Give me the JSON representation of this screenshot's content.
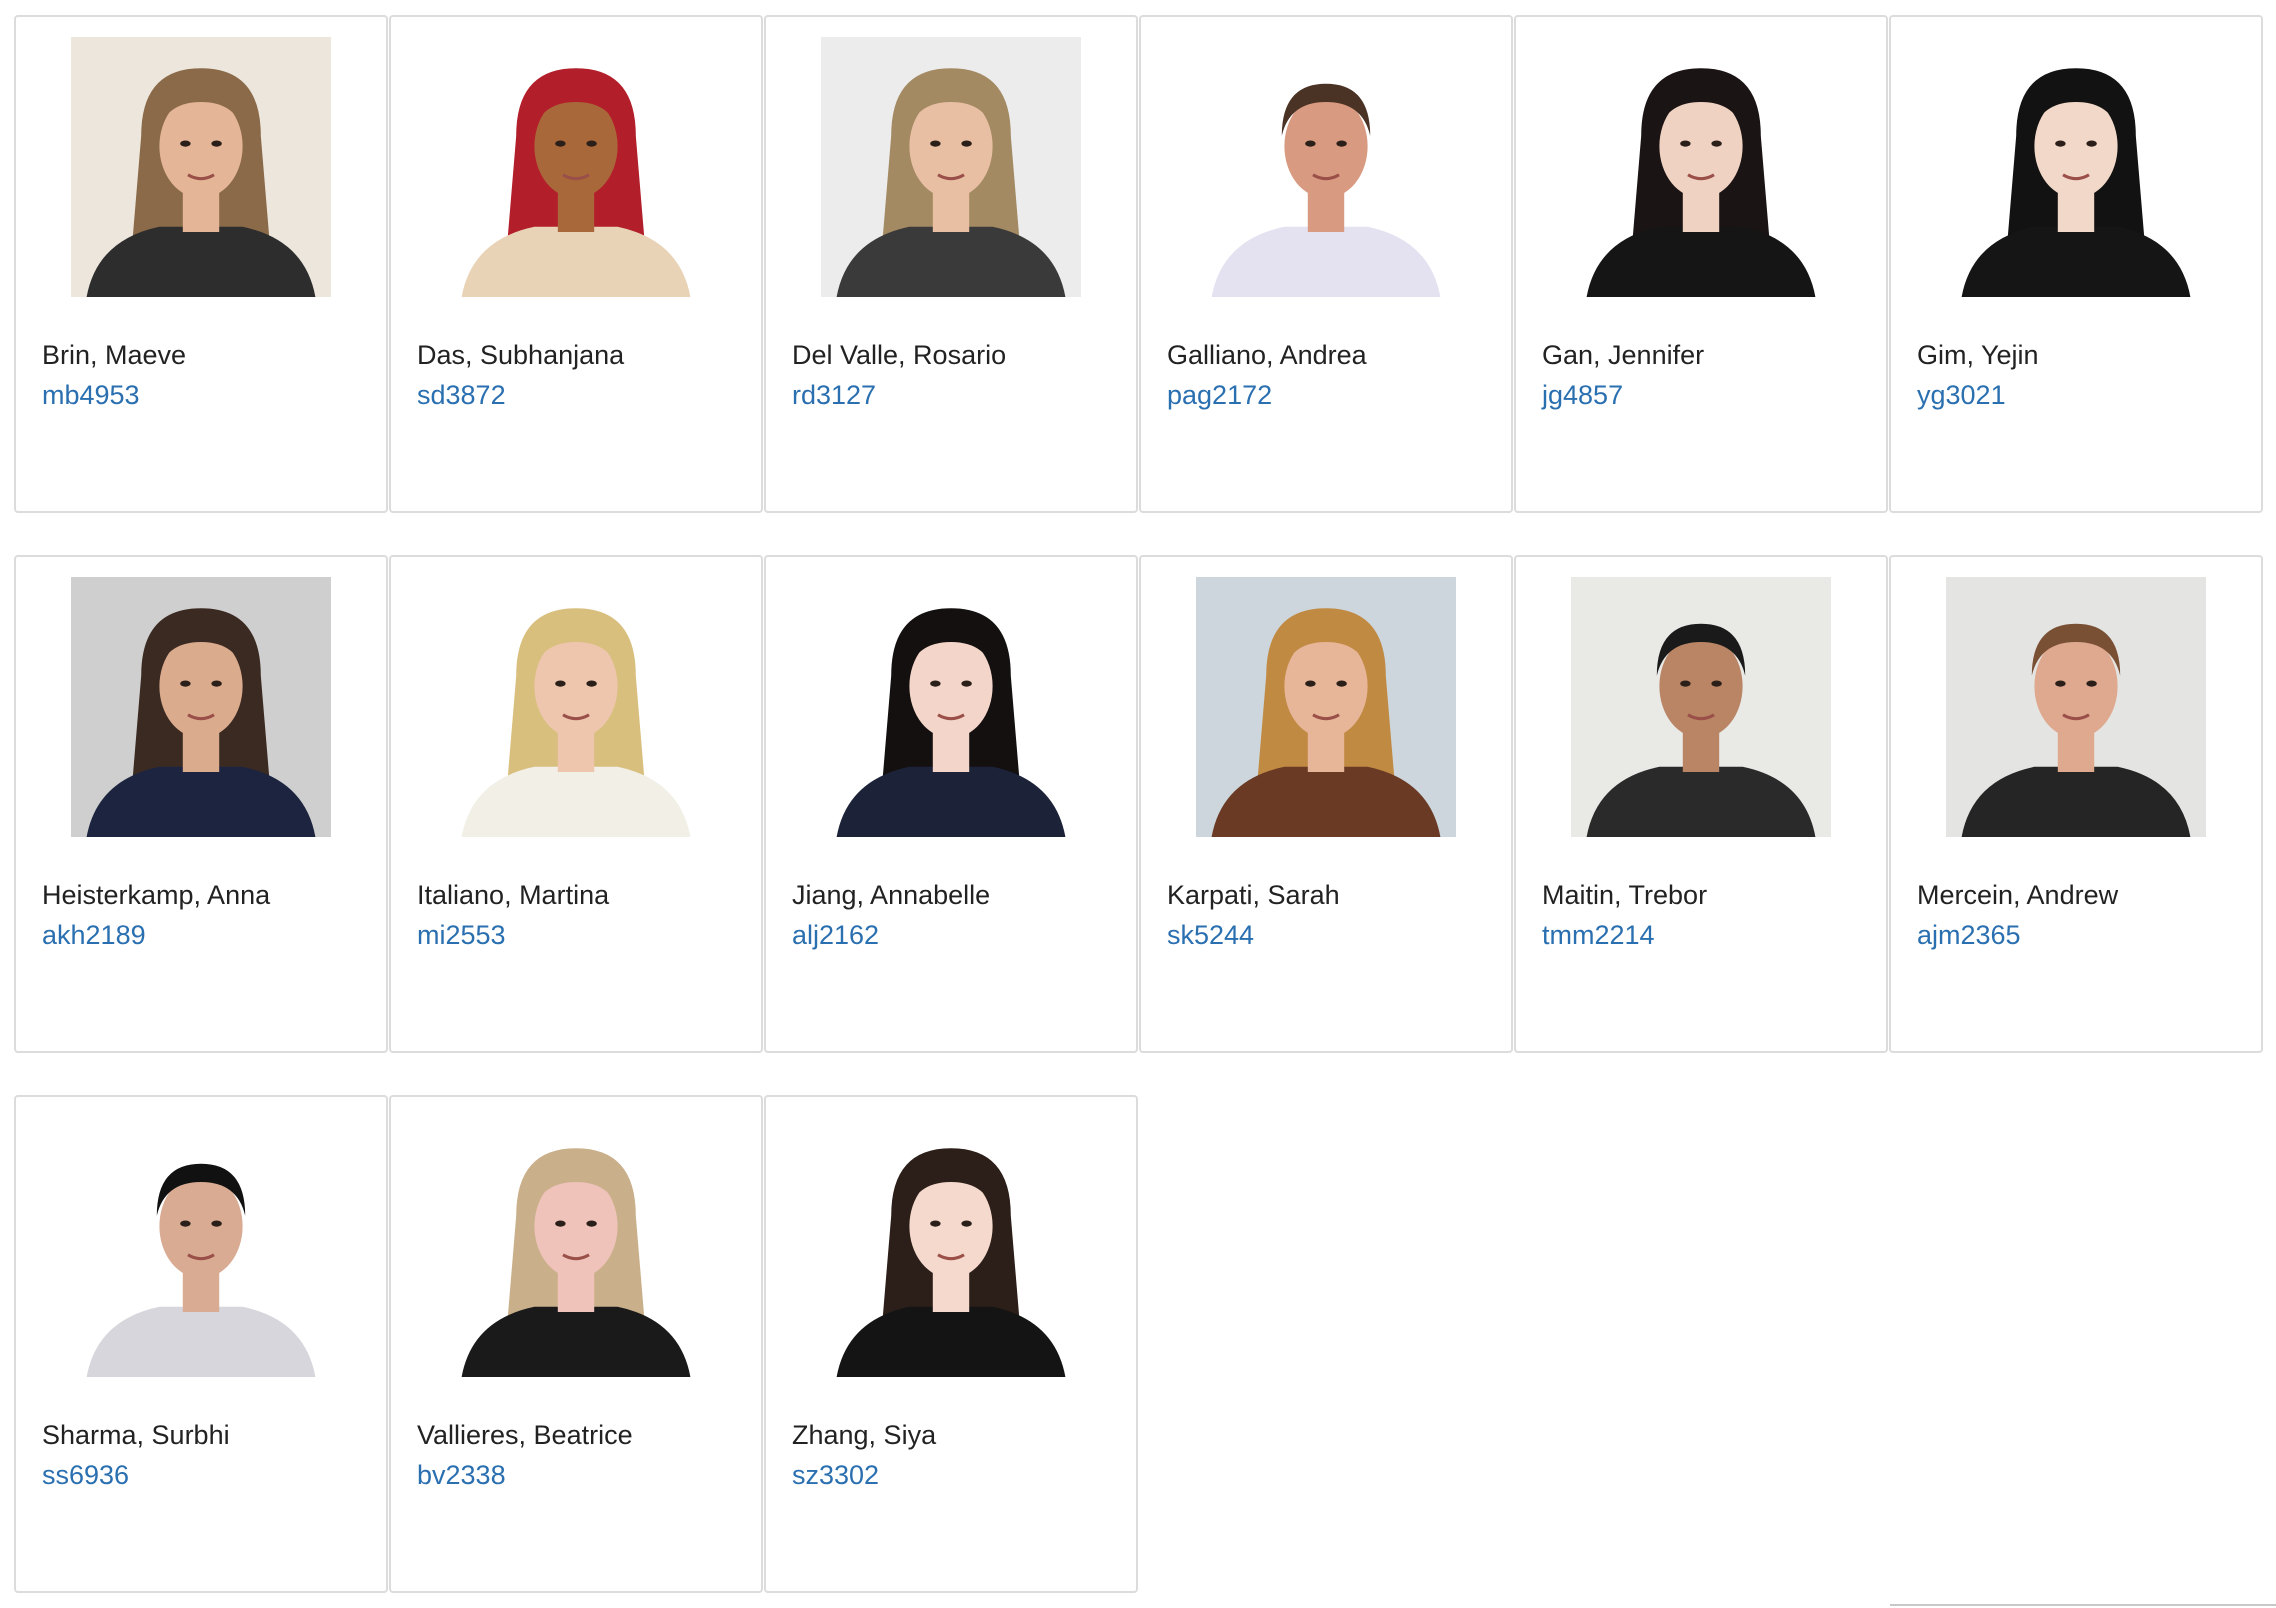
{
  "students": [
    {
      "name": "Brin, Maeve",
      "uni": "mb4953",
      "photo": {
        "bg": "#ece6dc",
        "skin": "#e4b596",
        "hair": "#8a6a48",
        "clothes": "#2d2d2d",
        "long_hair": true
      }
    },
    {
      "name": "Das, Subhanjana",
      "uni": "sd3872",
      "photo": {
        "bg": "#ffffff",
        "skin": "#a8683a",
        "hair": "#b21e2a",
        "clothes": "#e9d3b6",
        "long_hair": true
      }
    },
    {
      "name": "Del Valle, Rosario",
      "uni": "rd3127",
      "photo": {
        "bg": "#ececec",
        "skin": "#e9bfa4",
        "hair": "#a38a62",
        "clothes": "#3a3a3a",
        "long_hair": true
      }
    },
    {
      "name": "Galliano, Andrea",
      "uni": "pag2172",
      "photo": {
        "bg": "#ffffff",
        "skin": "#d89a80",
        "hair": "#4a3224",
        "clothes": "#e4e2f1",
        "long_hair": false
      }
    },
    {
      "name": "Gan, Jennifer",
      "uni": "jg4857",
      "photo": {
        "bg": "#ffffff",
        "skin": "#f0d2c2",
        "hair": "#1b1414",
        "clothes": "#151515",
        "long_hair": true
      }
    },
    {
      "name": "Gim, Yejin",
      "uni": "yg3021",
      "photo": {
        "bg": "#ffffff",
        "skin": "#f2d8c8",
        "hair": "#121212",
        "clothes": "#151515",
        "long_hair": true
      }
    },
    {
      "name": "Heisterkamp, Anna",
      "uni": "akh2189",
      "photo": {
        "bg": "#cfcfcf",
        "skin": "#dbab8e",
        "hair": "#3b2a22",
        "clothes": "#1c2440",
        "long_hair": true
      }
    },
    {
      "name": "Italiano, Martina",
      "uni": "mi2553",
      "photo": {
        "bg": "#ffffff",
        "skin": "#eec6ad",
        "hair": "#d9bf7e",
        "clothes": "#f2efe6",
        "long_hair": true
      }
    },
    {
      "name": "Jiang, Annabelle",
      "uni": "alj2162",
      "photo": {
        "bg": "#ffffff",
        "skin": "#f3d6c9",
        "hair": "#141010",
        "clothes": "#1c2238",
        "long_hair": true
      }
    },
    {
      "name": "Karpati, Sarah",
      "uni": "sk5244",
      "photo": {
        "bg": "#cdd6dc",
        "skin": "#e7b598",
        "hair": "#c08a43",
        "clothes": "#6a3a24",
        "long_hair": true
      }
    },
    {
      "name": "Maitin, Trebor",
      "uni": "tmm2214",
      "photo": {
        "bg": "#e9e9e6",
        "skin": "#b98565",
        "hair": "#1a1a1a",
        "clothes": "#2a2a2a",
        "long_hair": false
      }
    },
    {
      "name": "Mercein, Andrew",
      "uni": "ajm2365",
      "photo": {
        "bg": "#e4e4e2",
        "skin": "#dfa98f",
        "hair": "#7a5034",
        "clothes": "#252525",
        "long_hair": false
      }
    },
    {
      "name": "Sharma, Surbhi",
      "uni": "ss6936",
      "photo": {
        "bg": "#ffffff",
        "skin": "#d9ab92",
        "hair": "#111111",
        "clothes": "#d6d6dc",
        "long_hair": false
      }
    },
    {
      "name": "Vallieres, Beatrice",
      "uni": "bv2338",
      "photo": {
        "bg": "#ffffff",
        "skin": "#efc2ba",
        "hair": "#c9b08a",
        "clothes": "#1a1a1a",
        "long_hair": true
      }
    },
    {
      "name": "Zhang, Siya",
      "uni": "sz3302",
      "photo": {
        "bg": "#ffffff",
        "skin": "#f4d9cc",
        "hair": "#2c1e18",
        "clothes": "#141414",
        "long_hair": true
      }
    }
  ]
}
